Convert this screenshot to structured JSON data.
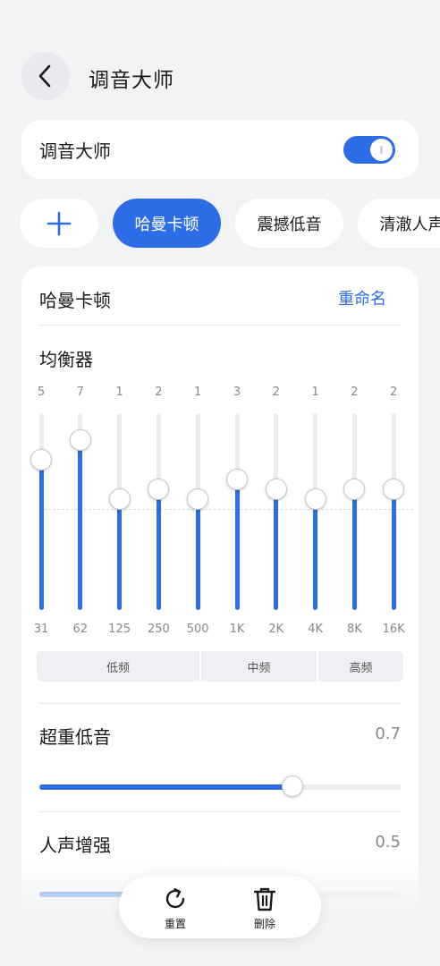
{
  "header": {
    "title": "调音大师",
    "back_icon": "chevron-left-icon"
  },
  "master_toggle": {
    "label": "调音大师",
    "enabled": true
  },
  "presets": {
    "add_icon": "plus-icon",
    "items": [
      {
        "label": "哈曼卡顿",
        "active": true
      },
      {
        "label": "震撼低音",
        "active": false
      },
      {
        "label": "清澈人声",
        "active": false
      }
    ]
  },
  "preset_card": {
    "name": "哈曼卡顿",
    "rename_label": "重命名",
    "equalizer": {
      "title": "均衡器",
      "bands": [
        {
          "freq": "31",
          "value": "5",
          "level": 5
        },
        {
          "freq": "62",
          "value": "7",
          "level": 7
        },
        {
          "freq": "125",
          "value": "1",
          "level": 1
        },
        {
          "freq": "250",
          "value": "2",
          "level": 2
        },
        {
          "freq": "500",
          "value": "1",
          "level": 1
        },
        {
          "freq": "1K",
          "value": "3",
          "level": 3
        },
        {
          "freq": "2K",
          "value": "2",
          "level": 2
        },
        {
          "freq": "4K",
          "value": "1",
          "level": 1
        },
        {
          "freq": "8K",
          "value": "2",
          "level": 2
        },
        {
          "freq": "16K",
          "value": "2",
          "level": 2
        }
      ],
      "groups": [
        {
          "label": "低频"
        },
        {
          "label": "中频"
        },
        {
          "label": "高频"
        }
      ]
    },
    "super_bass": {
      "label": "超重低音",
      "value": "0.7",
      "level": 0.7
    },
    "vocal_boost": {
      "label": "人声增强",
      "value": "0.5",
      "level": 0.5
    }
  },
  "bottom_bar": {
    "reset_label": "重置",
    "reset_icon": "refresh-icon",
    "delete_label": "删除",
    "delete_icon": "trash-icon"
  },
  "colors": {
    "accent": "#2d6ee8",
    "background": "#f1f3f5",
    "card": "#ffffff"
  }
}
